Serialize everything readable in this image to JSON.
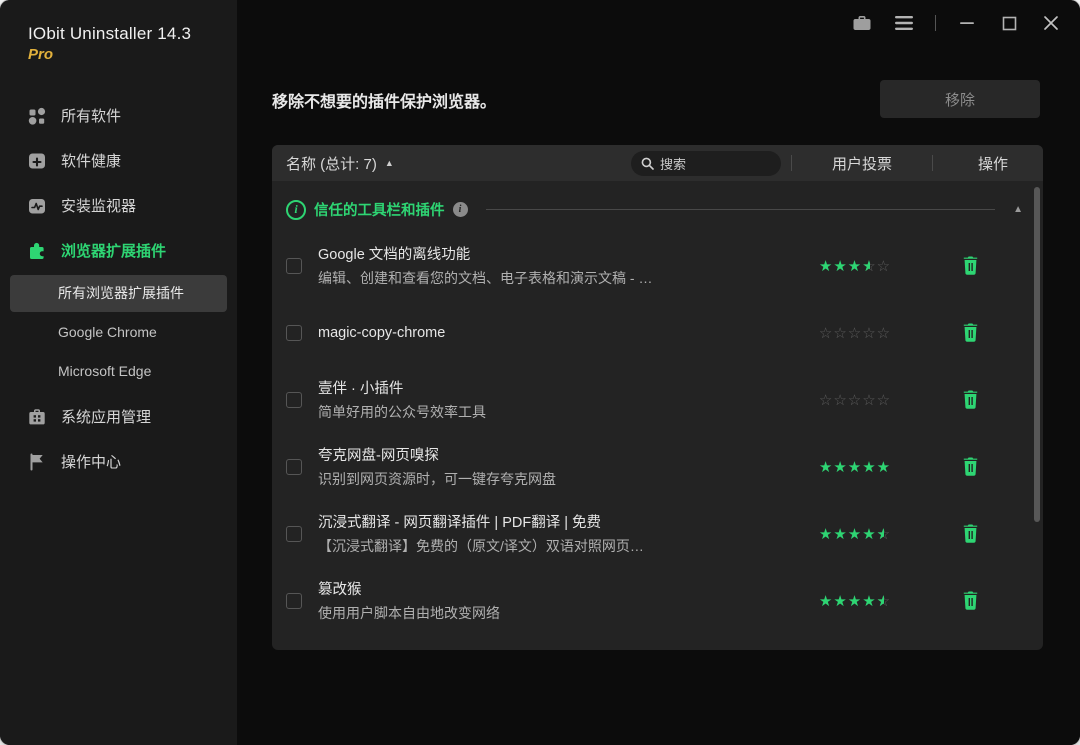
{
  "window": {
    "title": "IObit Uninstaller 14.3",
    "badge": "Pro"
  },
  "colors": {
    "accent": "#2ed573",
    "pro_badge": "#e2b13c",
    "star_empty": "#5c5c5c"
  },
  "sidebar": {
    "items": [
      {
        "label": "所有软件",
        "icon": "apps-grid-icon"
      },
      {
        "label": "软件健康",
        "icon": "software-health-icon"
      },
      {
        "label": "安装监视器",
        "icon": "install-monitor-icon"
      },
      {
        "label": "浏览器扩展插件",
        "icon": "puzzle-icon"
      }
    ],
    "sub_items": [
      {
        "label": "所有浏览器扩展插件"
      },
      {
        "label": "Google Chrome"
      },
      {
        "label": "Microsoft Edge"
      }
    ],
    "items_bottom": [
      {
        "label": "系统应用管理",
        "icon": "system-apps-icon"
      },
      {
        "label": "操作中心",
        "icon": "action-center-icon"
      }
    ]
  },
  "main": {
    "heading": "移除不想要的插件保护浏览器。",
    "remove_button": "移除",
    "table": {
      "name_header": "名称 (总计: 7)",
      "search_placeholder": "搜索",
      "votes_header": "用户投票",
      "actions_header": "操作"
    },
    "group": {
      "label": "信任的工具栏和插件"
    },
    "items": [
      {
        "name": "Google 文档的离线功能",
        "desc": "编辑、创建和查看您的文档、电子表格和演示文稿 - …",
        "rating": 3.5
      },
      {
        "name": "magic-copy-chrome",
        "desc": "",
        "rating": 0
      },
      {
        "name": "壹伴 · 小插件",
        "desc": "简单好用的公众号效率工具",
        "rating": 0
      },
      {
        "name": "夸克网盘-网页嗅探",
        "desc": "识别到网页资源时，可一键存夸克网盘",
        "rating": 5
      },
      {
        "name": "沉浸式翻译 - 网页翻译插件 | PDF翻译 | 免费",
        "desc": "【沉浸式翻译】免费的（原文/译文）双语对照网页…",
        "rating": 4.5
      },
      {
        "name": "篡改猴",
        "desc": "使用用户脚本自由地改变网络",
        "rating": 4.5
      }
    ]
  }
}
